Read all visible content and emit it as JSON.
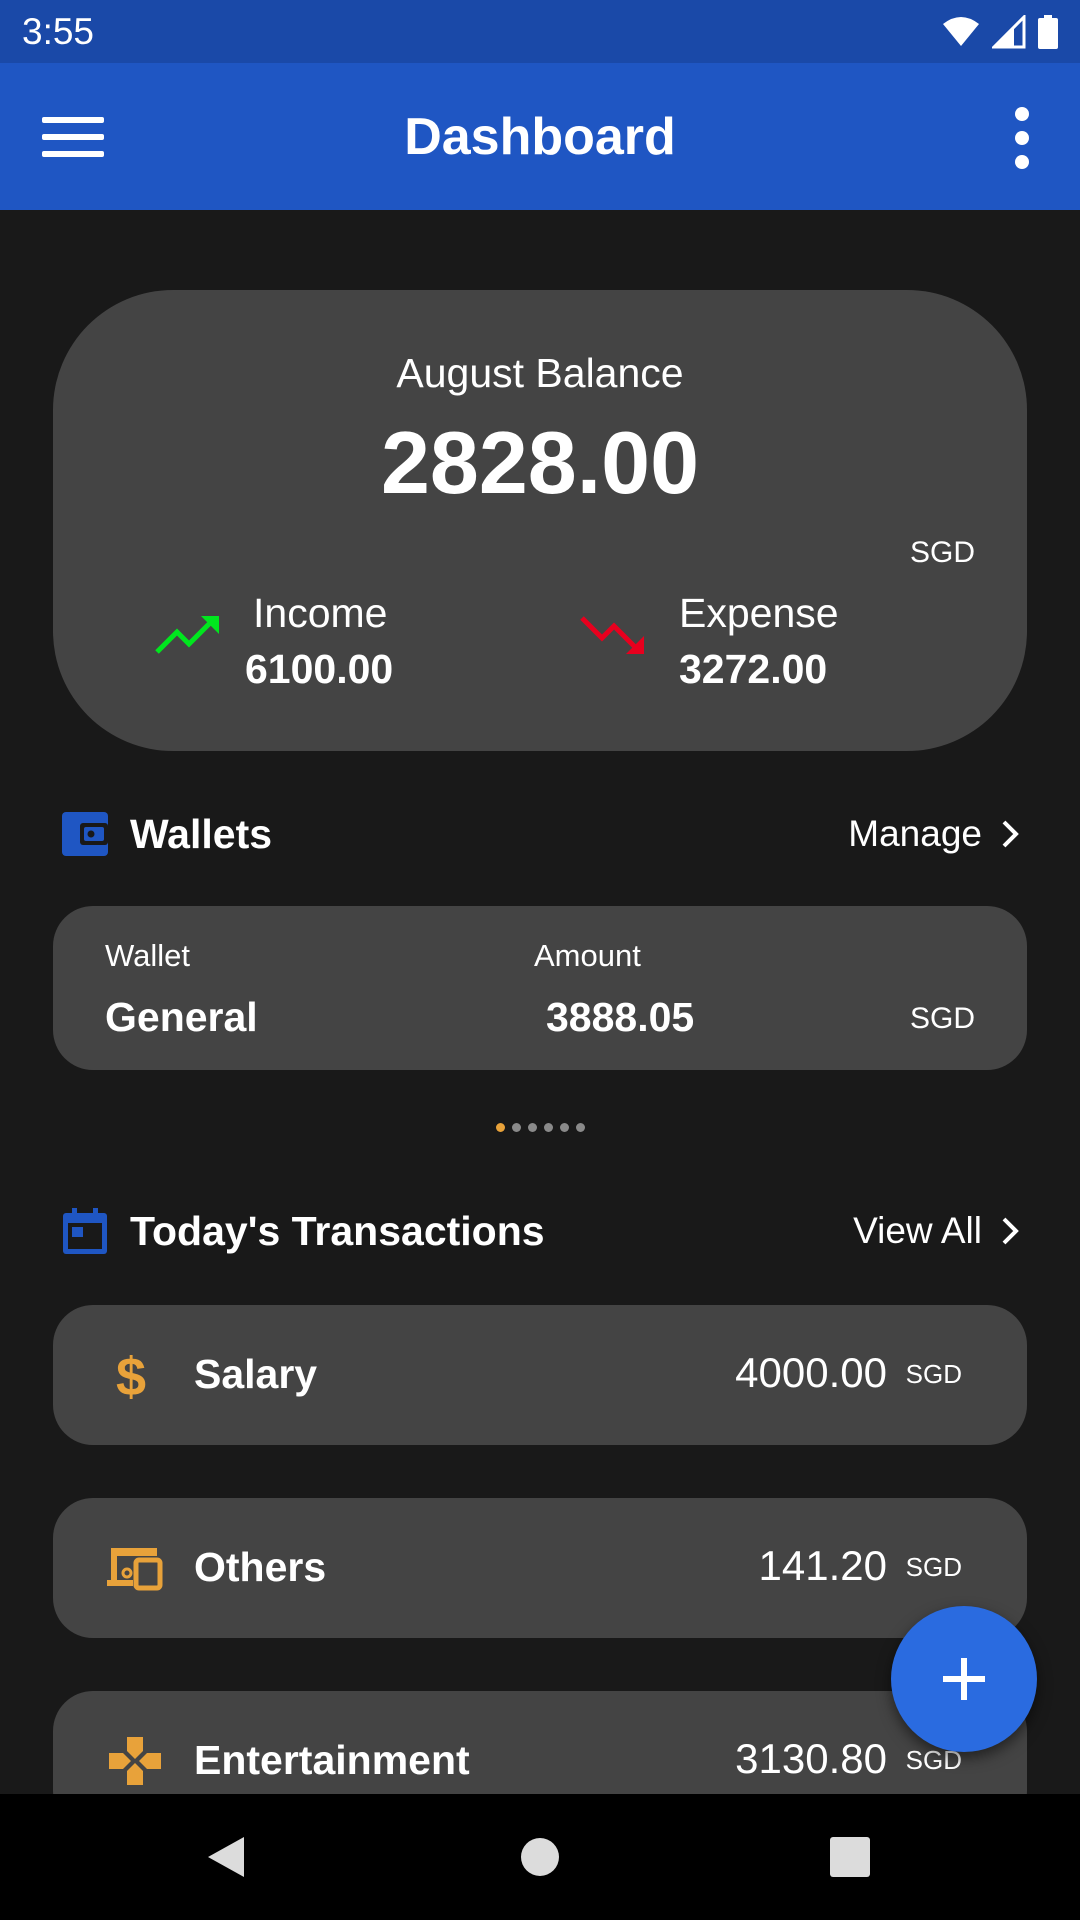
{
  "status_bar": {
    "time": "3:55"
  },
  "app_bar": {
    "title": "Dashboard"
  },
  "balance": {
    "title": "August Balance",
    "amount": "2828.00",
    "currency": "SGD",
    "income_label": "Income",
    "income_value": "6100.00",
    "expense_label": "Expense",
    "expense_value": "3272.00"
  },
  "wallets": {
    "title": "Wallets",
    "manage_label": "Manage",
    "col_wallet": "Wallet",
    "col_amount": "Amount",
    "name": "General",
    "amount": "3888.05",
    "currency": "SGD",
    "page_count": 6,
    "active_page": 1
  },
  "transactions": {
    "title": "Today's Transactions",
    "view_all_label": "View All",
    "items": [
      {
        "name": "Salary",
        "amount": "4000.00",
        "currency": "SGD",
        "icon": "dollar-icon"
      },
      {
        "name": "Others",
        "amount": "141.20",
        "currency": "SGD",
        "icon": "devices-icon"
      },
      {
        "name": "Entertainment",
        "amount": "3130.80",
        "currency": "SGD",
        "icon": "gamepad-icon"
      }
    ]
  },
  "colors": {
    "status_bar": "#1a49a8",
    "app_bar": "#1f56c3",
    "background": "#191919",
    "card": "#444444",
    "income_arrow": "#00e61e",
    "expense_arrow": "#e8001e",
    "accent_icon": "#e8a23a",
    "fab": "#2a6be0"
  },
  "icons": {
    "menu": "menu-icon",
    "more": "more-vert-icon",
    "wifi": "wifi-icon",
    "signal": "signal-icon",
    "battery": "battery-icon",
    "income": "trending-up-icon",
    "expense": "trending-down-icon",
    "wallet": "wallet-icon",
    "calendar": "calendar-icon",
    "add": "add-icon"
  }
}
